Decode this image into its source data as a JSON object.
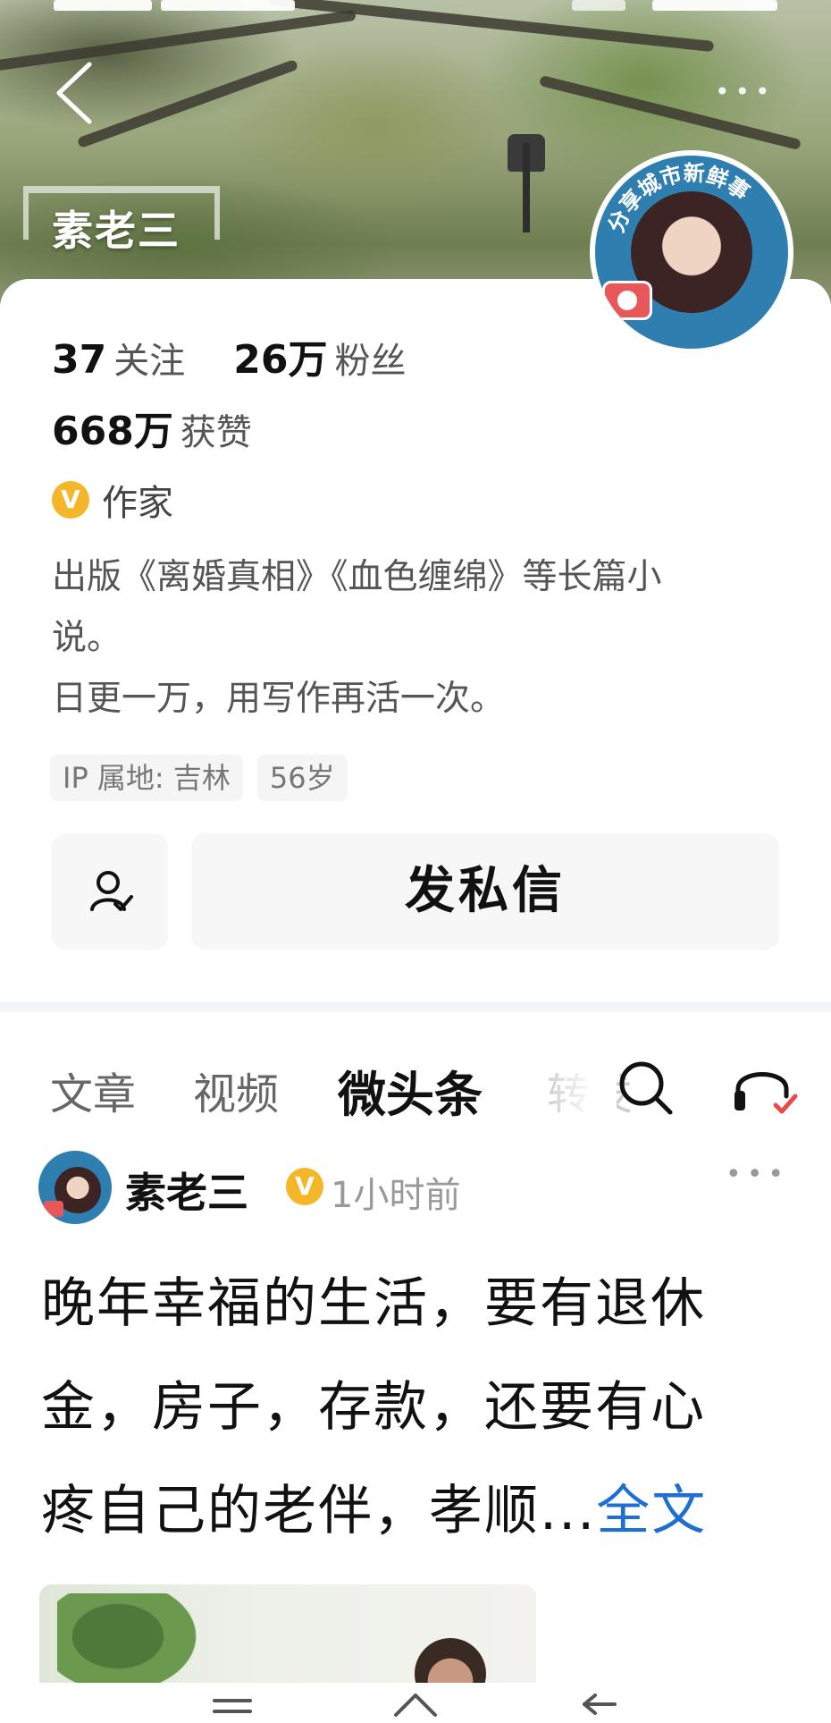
{
  "header": {
    "back_label": "back",
    "more_label": "•••",
    "profile_name": "素老三",
    "avatar_ring_text": "分享城市新鲜事"
  },
  "stats": {
    "following_count": "37",
    "following_label": "关注",
    "followers_count": "26万",
    "followers_label": "粉丝",
    "likes_count": "668万",
    "likes_label": "获赞"
  },
  "verification": {
    "badge": "V",
    "title": "作家"
  },
  "bio": {
    "line1": "出版《离婚真相》《血色缠绵》等长篇小",
    "line2": "说。",
    "line3": "日更一万，用写作再活一次。"
  },
  "tags": [
    {
      "label": "IP 属地: 吉林"
    },
    {
      "label": "56岁"
    }
  ],
  "actions": {
    "message_label": "发私信"
  },
  "tabs": [
    {
      "label": "文章"
    },
    {
      "label": "视频"
    },
    {
      "label": "微头条"
    },
    {
      "label": "转发"
    }
  ],
  "post": {
    "author": "素老三",
    "badge": "V",
    "time": "1小时前",
    "more": "•••",
    "line1": "晚年幸福的生活，要有退休",
    "line2": "金，房子，存款，还要有心",
    "line3": "疼自己的老伴，孝顺...",
    "full_text_link": "全文"
  },
  "icons": {
    "back": "chevron-left-icon",
    "more": "more-dots-icon",
    "follow": "user-add-icon",
    "search": "search-icon",
    "listen": "headphones-icon",
    "verify": "verified-v-icon"
  },
  "colors": {
    "verify_badge": "#f6b62a",
    "link": "#1e6fd0",
    "avatar_ring": "#2e7fb0"
  }
}
